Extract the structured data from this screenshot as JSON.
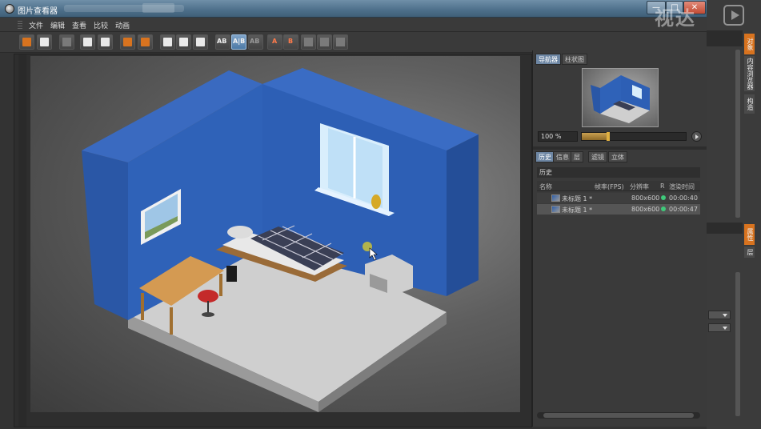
{
  "window": {
    "title": "图片查看器",
    "minimize_label": "—",
    "maximize_label": "□",
    "close_label": "✕"
  },
  "menu": [
    "文件",
    "编辑",
    "查看",
    "比较",
    "动画"
  ],
  "toolbar": {
    "buttons": [
      {
        "name": "open-image-icon",
        "style": "orange"
      },
      {
        "name": "save-image-icon",
        "style": "white"
      },
      {
        "name": "grid-icon",
        "style": "dim"
      },
      {
        "name": "render-icon",
        "style": "white"
      },
      {
        "name": "person-icon",
        "style": "white"
      },
      {
        "name": "copy-icon",
        "style": "orange"
      },
      {
        "name": "copy-alt-icon",
        "style": "orange"
      },
      {
        "name": "frame-icon",
        "style": "white"
      },
      {
        "name": "frame-save-icon",
        "style": "white"
      },
      {
        "name": "group-icon",
        "style": "white"
      }
    ],
    "ab_labels": [
      "AB",
      "A|B",
      "AB",
      "A",
      "B"
    ]
  },
  "navigator": {
    "tabs": [
      "导航器",
      "柱状图"
    ],
    "zoom_value": "100 %",
    "zoom_fraction": 0.25
  },
  "history": {
    "tabs": [
      "历史",
      "信息",
      "层",
      "滤镜",
      "立体"
    ],
    "section_label": "历史",
    "columns": {
      "name": "名称",
      "fps": "帧率(FPS)",
      "resolution": "分辨率",
      "r": "R",
      "render_time": "渲染时间"
    },
    "rows": [
      {
        "name": "未标题 1 *",
        "resolution": "800x600",
        "time": "00:00:40",
        "selected": false
      },
      {
        "name": "未标题 1 *",
        "resolution": "800x600",
        "time": "00:00:47",
        "selected": true
      }
    ]
  },
  "right_edge": {
    "tabs": [
      "对象",
      "内容浏览器",
      "构造",
      "属性",
      "层"
    ]
  },
  "watermark": "视达",
  "colors": {
    "accent": "#d8731f",
    "wall": "#2f5fb0",
    "status_green": "#3fc97a"
  }
}
